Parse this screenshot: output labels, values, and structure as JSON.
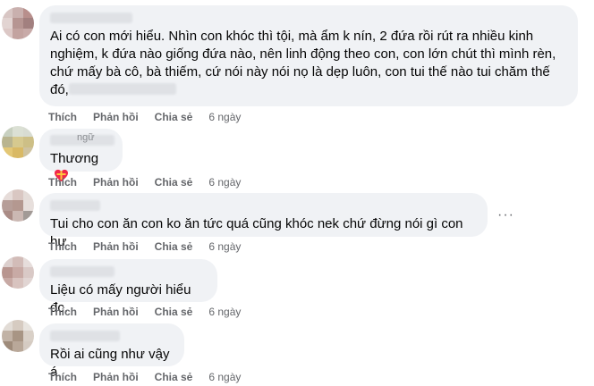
{
  "actions": {
    "like": "Thích",
    "reply": "Phản hồi",
    "share": "Chia sẻ"
  },
  "comments": [
    {
      "text_line1": "Ai có con mới hiểu. Nhìn con khóc thì tội, mà ẩm k nín, 2 đứa rồi rút ra nhiều kinh",
      "text_line2": "nghiệm, k đứa nào giống đứa nào, nên linh động theo con, con lớn chút thì mình rèn,",
      "text_line3": "chứ mấy bà cô, bà thiếm, cứ nói này nói nọ là dẹp luôn, con tui thế nào tui chăm thế",
      "text_line4": "đó,",
      "time": "6 ngày"
    },
    {
      "name_partial": "ngữ",
      "text": "Thương",
      "time": "6 ngày",
      "emoji": "heart-gift-icon"
    },
    {
      "text": "Tui cho con ăn con ko ăn tức quá cũng khóc nek chứ đừng nói gì con hư",
      "time": "6 ngày",
      "more": "···"
    },
    {
      "text": "Liệu có mấy người hiểu đc.",
      "time": "6 ngày"
    },
    {
      "text": "Rồi ai cũng như vậy á",
      "time": "6 ngày"
    }
  ],
  "colors": {
    "bubble": "#f0f2f5",
    "meta_text": "#65676b",
    "heart": "#f0284a"
  }
}
